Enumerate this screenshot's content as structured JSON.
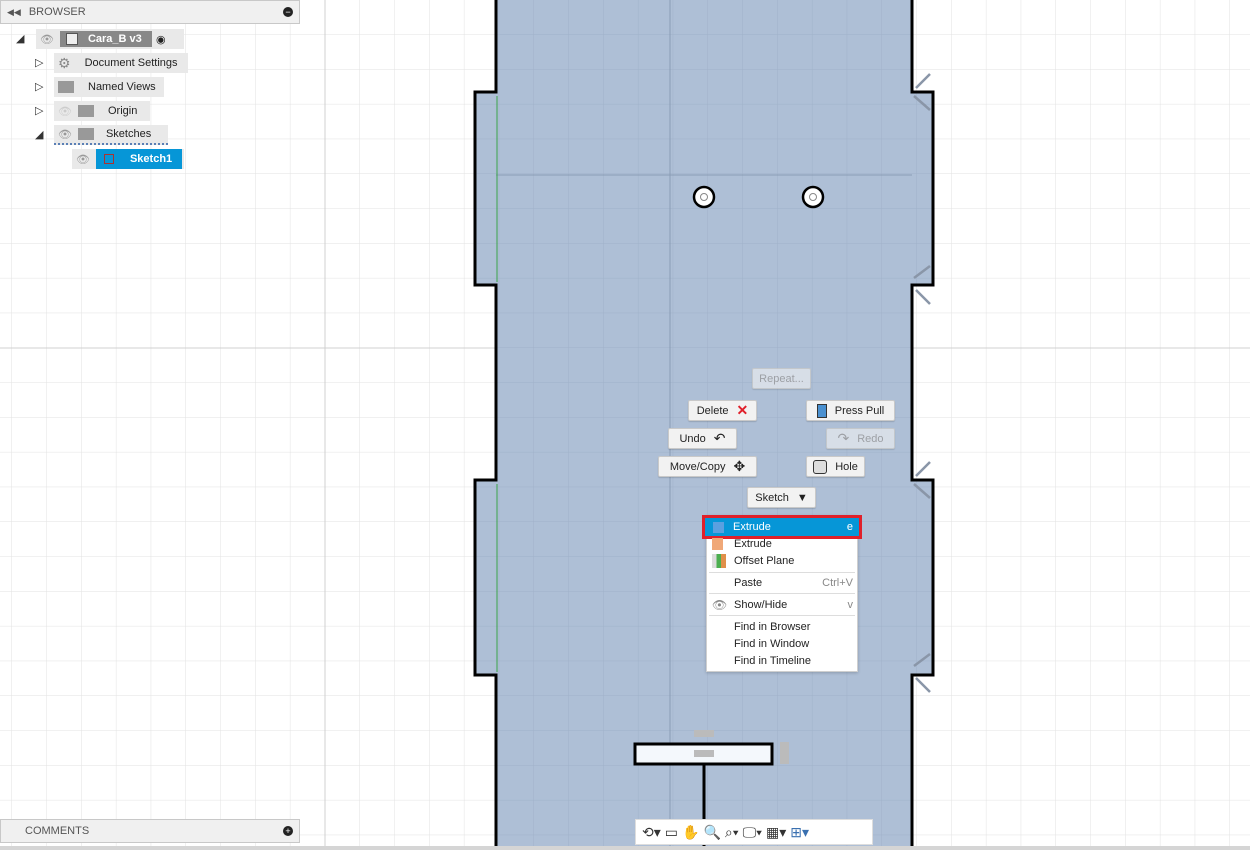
{
  "browser": {
    "title": "BROWSER",
    "root": "Cara_B v3",
    "items": [
      {
        "label": "Document Settings",
        "icon": "gear-icon"
      },
      {
        "label": "Named Views",
        "icon": "folder-icon"
      },
      {
        "label": "Origin",
        "icon": "folder-icon"
      },
      {
        "label": "Sketches",
        "icon": "folder-icon"
      }
    ],
    "sketch": "Sketch1"
  },
  "comments": {
    "title": "COMMENTS"
  },
  "marking_menu": {
    "repeat": "Repeat...",
    "delete": "Delete",
    "press_pull": "Press Pull",
    "undo": "Undo",
    "redo": "Redo",
    "move_copy": "Move/Copy",
    "hole": "Hole",
    "sketch": "Sketch"
  },
  "context_menu": {
    "items": [
      {
        "label": "Extrude",
        "shortcut": "e",
        "highlighted": true
      },
      {
        "label": "Extrude"
      },
      {
        "label": "Offset Plane"
      },
      {
        "label": "Paste",
        "shortcut": "Ctrl+V"
      },
      {
        "label": "Show/Hide",
        "shortcut": "v"
      },
      {
        "label": "Find in Browser"
      },
      {
        "label": "Find in Window"
      },
      {
        "label": "Find in Timeline"
      }
    ]
  },
  "colors": {
    "accent": "#0696d7",
    "highlight_border": "#e0202a",
    "sketch_fill": "#aebfd6"
  }
}
